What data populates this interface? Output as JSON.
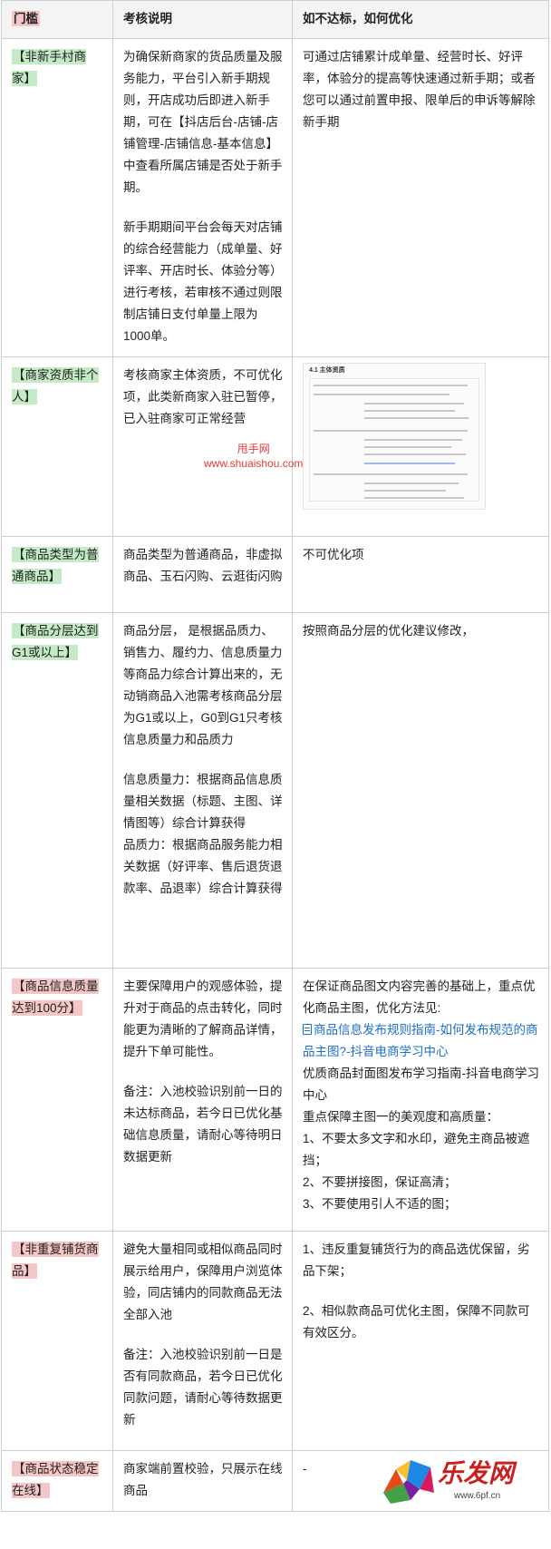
{
  "header": {
    "col1": "门槛",
    "col2": "考核说明",
    "col3": "如不达标，如何优化"
  },
  "rows": [
    {
      "tag": "【非新手村商家】",
      "desc": [
        "为确保新商家的货品质量及服务能力，平台引入新手期规则，开店成功后即进入新手期，可在【抖店后台-店铺-店铺管理-店铺信息-基本信息】中查看所属店铺是否处于新手期。",
        "新手期期间平台会每天对店铺的综合经营能力（成单量、好评率、开店时长、体验分等）进行考核，若审核不通过则限制店铺日支付单量上限为1000单。"
      ],
      "fix": "可通过店铺累计成单量、经营时长、好评率，体验分的提高等快速通过新手期；或者您可以通过前置申报、限单后的申诉等解除新手期"
    },
    {
      "tag": "【商家资质非个人】",
      "desc": "考核商家主体资质，不可优化项，此类新商家入驻已暂停，已入驻商家可正常经营",
      "thumb_title": "4.1 主体资质"
    },
    {
      "tag": "【商品类型为普通商品】",
      "desc": "商品类型为普通商品，非虚拟商品、玉石闪购、云逛街闪购",
      "fix": "不可优化项"
    },
    {
      "tag": "【商品分层达到G1或以上】",
      "desc": [
        "商品分层， 是根据品质力、销售力、履约力、信息质量力等商品力综合计算出来的，无动销商品入池需考核商品分层为G1或以上，G0到G1只考核信息质量力和品质力",
        "信息质量力：根据商品信息质量相关数据（标题、主图、详情图等）综合计算获得"
      ],
      "desc_extra": "品质力：根据商品服务能力相关数据（好评率、售后退货退款率、品退率）综合计算获得",
      "fix": "按照商品分层的优化建议修改，"
    },
    {
      "tag": "【商品信息质量达到100分】",
      "desc": [
        "主要保障用户的观感体验，提升对于商品的点击转化，同时能更为清晰的了解商品详情，提升下单可能性。",
        "备注：入池校验识别前一日的未达标商品，若今日已优化基础信息质量，请耐心等待明日数据更新"
      ],
      "fix_intro": "在保证商品图文内容完善的基础上，重点优化商品主图，优化方法见:",
      "fix_link": "商品信息发布规则指南-如何发布规范的商品主图?-抖音电商学习中心",
      "fix_lines": [
        "优质商品封面图发布学习指南-抖音电商学习中心",
        "重点保障主图一的美观度和高质量：",
        "1、不要太多文字和水印，避免主商品被遮挡；",
        "2、不要拼接图，保证高清；",
        "3、不要使用引人不适的图；"
      ]
    },
    {
      "tag": "【非重复铺货商品】",
      "desc": [
        "避免大量相同或相似商品同时展示给用户，保障用户浏览体验，同店铺内的同款商品无法全部入池",
        "备注：入池校验识别前一日是否有同款商品，若今日已优化同款问题，请耐心等待数据更新"
      ],
      "fix": [
        "1、违反重复铺货行为的商品选优保留，劣品下架；",
        "2、相似款商品可优化主图，保障不同款可有效区分。"
      ]
    },
    {
      "tag": "【商品状态稳定在线】",
      "desc": "商家端前置校验，只展示在线商品",
      "fix": "-"
    }
  ],
  "watermark": {
    "line1": "甩手网",
    "line2": "www.shuaishou.com"
  },
  "logo": {
    "text": "乐发网",
    "url": "www.6pf.cn"
  },
  "colors": {
    "green_highlight": "#c4ebc6",
    "red_highlight": "#f5c6c6",
    "link": "#1d6fc7"
  }
}
